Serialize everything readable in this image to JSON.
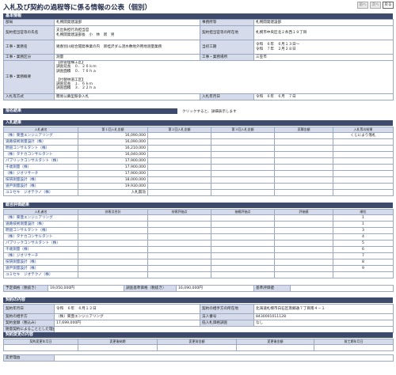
{
  "page": {
    "title": "入札及び契約の過程等に係る情報の公表（個別）",
    "nav": [
      "前へ",
      "次へ",
      "戻る"
    ]
  },
  "basic": {
    "header": "基本情報",
    "dept_label": "部局",
    "dept": "札幌開発建設部",
    "office_label": "事務所等",
    "office": "札幌開発建設部",
    "officer_label": "契約担当官等の氏名",
    "officer_line1": "支出負担行為担当官",
    "officer_line2": "札幌開発建設部長　小　林　新　男",
    "officer_addr_label": "契約担当官等の所在地",
    "officer_addr": "札幌市中央区北２条西１９丁目",
    "work_name_label": "工事・業務名",
    "work_name": "幾春別川総合開発事業の内　新桂沢ダム湛水敷地外用地測量業務",
    "period_label": "当初工期",
    "period_line1": "令和　６年　６月１３日～",
    "period_line2": "令和　７年　２月２８日",
    "work_type_label": "工事・業務区分",
    "work_type": "測量",
    "place_label": "工事・業務場所",
    "place": "三笠市",
    "summary_label": "工事・業務概要",
    "summary_lines": [
      "【新管理棟工区】",
      "調査延長　０．２６ｋｍ",
      "調査面積　０．７６ｈａ",
      "",
      "【付替林道工区】",
      "調査延長　１．６ｋｍ",
      "調査面積　３．２２ｈａ"
    ],
    "method_label": "入札等方式",
    "method": "簡易公募型競争入札",
    "bid_date_label": "入札年月日",
    "bid_date": "令和　６年　６月　７日"
  },
  "designation": {
    "header": "指名結果",
    "note": "クリックすると、詳細表示します"
  },
  "bid_results": {
    "header": "入札結果",
    "columns": [
      "入札者名",
      "第１回入札金額",
      "第２回入札金額",
      "第３回入札金額",
      "見積金額",
      "入札等の結果"
    ],
    "rows": [
      [
        "（株）東亜エンジニアリング",
        "16,090,000",
        "",
        "",
        "",
        "くじにより落札"
      ],
      [
        "道路技術測量設計（株）",
        "16,090,000",
        "",
        "",
        "",
        ""
      ],
      [
        "明道コンサルタント（株）",
        "16,210,000",
        "",
        "",
        "",
        ""
      ],
      [
        "（株）タナカコンサルタント",
        "16,040,000",
        "",
        "",
        "",
        ""
      ],
      [
        "パブリックコンサルタント（株）",
        "17,900,000",
        "",
        "",
        "",
        ""
      ],
      [
        "千歳測量（株）",
        "17,900,000",
        "",
        "",
        "",
        ""
      ],
      [
        "（株）ジオリサーチ",
        "17,900,000",
        "",
        "",
        "",
        ""
      ],
      [
        "技研測量設計（株）",
        "18,000,000",
        "",
        "",
        "",
        ""
      ],
      [
        "道戸測量設計（株）",
        "19,930,000",
        "",
        "",
        "",
        ""
      ],
      [
        "ユミセキ　ジオテクノ（株）",
        "入札無効",
        "",
        "",
        "",
        ""
      ]
    ]
  },
  "eval_results": {
    "header": "総合評価結果",
    "columns": [
      "入札者名",
      "技術点合計",
      "技術評価点",
      "価格評価点",
      "評価値",
      "順位"
    ],
    "rows": [
      [
        "（株）東亜エンジニアリング",
        "",
        "",
        "",
        "",
        "1"
      ],
      [
        "道路技術測量設計（株）",
        "",
        "",
        "",
        "",
        "1"
      ],
      [
        "明道コンサルタント（株）",
        "",
        "",
        "",
        "",
        "3"
      ],
      [
        "（株）タナカコンサルタント",
        "",
        "",
        "",
        "",
        "4"
      ],
      [
        "パブリックコンサルタント（株）",
        "",
        "",
        "",
        "",
        "5"
      ],
      [
        "千歳測量（株）",
        "",
        "",
        "",
        "",
        "6"
      ],
      [
        "（株）ジオリサーチ",
        "",
        "",
        "",
        "",
        "7"
      ],
      [
        "技研測量設計（株）",
        "",
        "",
        "",
        "",
        "8"
      ],
      [
        "道戸測量設計（株）",
        "",
        "",
        "",
        "",
        "9"
      ],
      [
        "ユミセキ　ジオテクノ（株）",
        "",
        "",
        "",
        "",
        ""
      ]
    ],
    "planned_label": "予定価格（税抜き）",
    "planned": "19,050,000円",
    "standard_label": "調査基準価格（税抜き）",
    "standard": "16,090,000円",
    "criteria_label": "基準評価値",
    "criteria": ""
  },
  "contract": {
    "header": "契約の内容",
    "date_label": "契約年月日",
    "date": "令和　６年　６月１２日",
    "addr_label": "契約の相手方の所在地",
    "addr": "北海道札幌市白石区南郷通７丁目南４－１",
    "party_label": "契約の相手方",
    "party": "（株）東亜エンジニアリング",
    "corp_label": "法人番号",
    "corp": "8430001011128",
    "amount_label": "契約金額（税込み）",
    "amount": "17,699,000円",
    "low_label": "低入札価格調査",
    "low": "なし",
    "reason_label": "随意契約によることとした理由",
    "reason": ""
  },
  "changes": {
    "header": "契約変更の内容",
    "columns": [
      "契約変更年月日",
      "変更後納期",
      "変更前金額",
      "変更後金額",
      "前工期年月日"
    ],
    "reason_label": "変更理由",
    "reason": ""
  }
}
